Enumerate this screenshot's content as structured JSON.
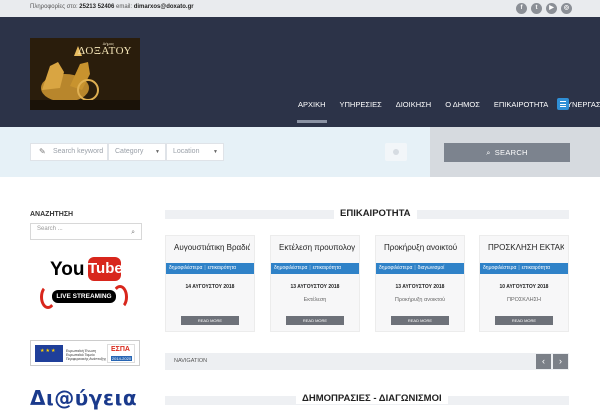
{
  "topbar": {
    "info_prefix": "Πληροφορίες στο:",
    "phone": "25213 52406",
    "email_label": "email:",
    "email": "dimarxos@doxato.gr",
    "social": [
      {
        "icon": "facebook-icon",
        "glyph": "f"
      },
      {
        "icon": "twitter-icon",
        "glyph": "t"
      },
      {
        "icon": "youtube-icon",
        "glyph": "▶"
      },
      {
        "icon": "instagram-icon",
        "glyph": "◎"
      }
    ]
  },
  "header": {
    "logo_super": "Δήμος",
    "logo_title": "ΔΟΞΑΤΟΥ",
    "nav": [
      {
        "label": "ΑΡΧΙΚΗ",
        "active": true
      },
      {
        "label": "ΥΠΗΡΕΣΙΕΣ"
      },
      {
        "label": "ΔΙΟΙΚΗΣΗ"
      },
      {
        "label": "Ο ΔΗΜΟΣ"
      },
      {
        "label": "ΕΠΙΚΑΙΡΟΤΗΤΑ"
      },
      {
        "label": "ΣΥΝΕΡΓΑΣΙΕΣ"
      }
    ],
    "menu_icon": "hamburger-icon"
  },
  "search": {
    "keyword_placeholder": "Search keyword",
    "category": "Category",
    "location": "Location",
    "button_label": "SEARCH"
  },
  "sidebar": {
    "title": "ΑΝΑΖΗΤΗΣΗ",
    "search_placeholder": "Search ...",
    "youtube_word": "You",
    "youtube_tube": "Tube",
    "live_label": "LIVE STREAMING",
    "espa_text": "Ευρωπαϊκή Ένωση Ευρωπαϊκό Ταμείο Περιφερειακής Ανάπτυξης",
    "espa_logo": "ΕΣΠΑ",
    "espa_years": "2014-2020",
    "partner_text": "Δι@ύγεια"
  },
  "main": {
    "section1_title": "ΕΠΙΚΑΙΡΟΤΗΤΑ",
    "section2_title": "ΔΗΜΟΠΡΑΣΙΕΣ - ΔΙΑΓΩΝΙΣΜΟΙ",
    "cards": [
      {
        "title": "Αυγουστιάτικη Βραδιά",
        "tag1": "δημοφιλέστερα",
        "tag2": "επικαιρότητα",
        "date": "14 ΑΥΓΟΥΣΤΟΥ 2018",
        "excerpt": "",
        "more": "READ MORE"
      },
      {
        "title": "Εκτέλεση προυπολογισμού",
        "tag1": "δημοφιλέστερα",
        "tag2": "επικαιρότητα",
        "date": "13 ΑΥΓΟΥΣΤΟΥ 2018",
        "excerpt": "Εκτέλεση",
        "more": "READ MORE"
      },
      {
        "title": "Προκήρυξη ανοικτού",
        "tag1": "δημοφιλέστερα",
        "tag2": "διαγωνισμοί",
        "date": "13 ΑΥΓΟΥΣΤΟΥ 2018",
        "excerpt": "Προκήρυξη ανοικτού",
        "more": "READ MORE"
      },
      {
        "title": "ΠΡΟΣΚΛΗΣΗ ΕΚΤΑΚΤΗΣ",
        "tag1": "δημοφιλέστερα",
        "tag2": "επικαιρότητα",
        "date": "10 ΑΥΓΟΥΣΤΟΥ 2018",
        "excerpt": "ΠΡΟΣΚΛΗΣΗ",
        "more": "READ MORE"
      }
    ],
    "navigation_label": "NAVIGATION"
  }
}
